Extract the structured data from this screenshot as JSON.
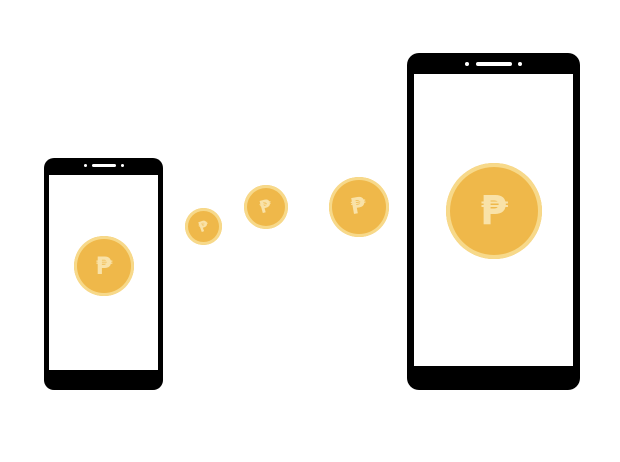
{
  "colors": {
    "background": "#ffffff",
    "phone_body": "#000000",
    "phone_screen": "#ffffff",
    "coin_fill": "#efb84a",
    "coin_rim": "#f7d98a",
    "coin_symbol": "#f9e2a8"
  },
  "icons": {
    "coin_symbol": "peso-sign"
  },
  "coins": {
    "symbol": "₱"
  }
}
